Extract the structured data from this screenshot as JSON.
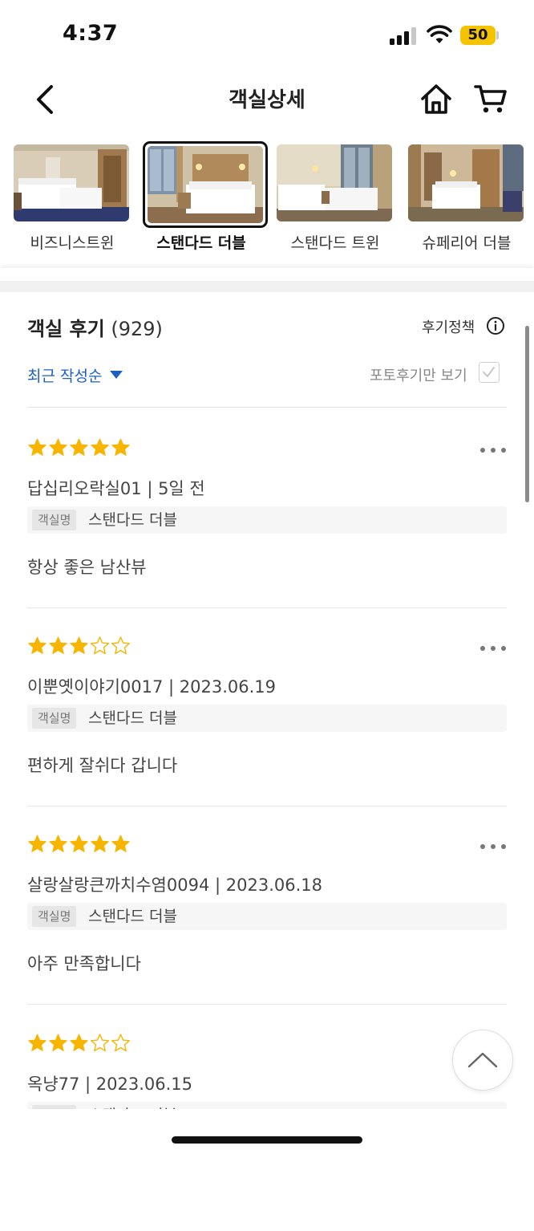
{
  "status_bar": {
    "time": "4:37",
    "battery": "50"
  },
  "header": {
    "title": "객실상세",
    "icons": [
      "back-arrow-icon",
      "home-icon",
      "cart-icon"
    ]
  },
  "rooms": [
    {
      "label": "비즈니스트윈",
      "selected": false
    },
    {
      "label": "스탠다드 더블",
      "selected": true
    },
    {
      "label": "스탠다드 트윈",
      "selected": false
    },
    {
      "label": "슈페리어 더블",
      "selected": false
    }
  ],
  "reviews_section": {
    "title": "객실 후기",
    "count": "(929)",
    "policy_label": "후기정책",
    "sort_label": "최근 작성순",
    "photo_only_label": "포토후기만 보기",
    "photo_only_checked": false
  },
  "reviews": [
    {
      "rating": 5,
      "meta": "답십리오락실01 | 5일 전",
      "room_tag": "객실명",
      "room_name": "스탠다드 더블",
      "content": "항상 좋은 남산뷰"
    },
    {
      "rating": 3,
      "meta": "이뿐옛이야기0017 | 2023.06.19",
      "room_tag": "객실명",
      "room_name": "스탠다드 더블",
      "content": "편하게 잘쉬다 갑니다"
    },
    {
      "rating": 5,
      "meta": "살랑살랑큰까치수염0094 | 2023.06.18",
      "room_tag": "객실명",
      "room_name": "스탠다드 더블",
      "content": "아주 만족합니다"
    },
    {
      "rating": 3,
      "meta": "옥냥77 | 2023.06.15",
      "room_tag": "객실명",
      "room_name": "스탠다드 더블",
      "content": ""
    }
  ],
  "colors": {
    "star": "#f7b500",
    "sort_link": "#1e5fbf",
    "battery": "#f5c400"
  }
}
